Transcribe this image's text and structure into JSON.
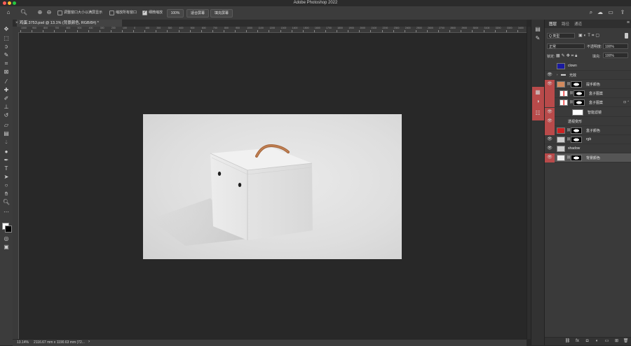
{
  "app": {
    "title": "Adobe Photoshop 2022"
  },
  "window_buttons": {
    "close": "#ff5f57",
    "minimize": "#febc2e",
    "zoom": "#28c840"
  },
  "options_bar": {
    "resize_windows_label": "调整窗口大小以满屏显示",
    "resize_windows_checked": false,
    "zoom_all_label": "缩放所有窗口",
    "zoom_all_checked": false,
    "scrubby_zoom_label": "细微缩放",
    "scrubby_zoom_checked": true,
    "percent_label": "100%",
    "fit_screen_label": "适合屏幕",
    "fill_screen_label": "填充屏幕"
  },
  "document": {
    "tab_title": "鸡蛋.3753.psd @ 13.1% (背景颜色, RGB/8#) *",
    "background_color": "#dedede"
  },
  "ruler": {
    "h_labels": [
      "1000",
      "900",
      "800",
      "700",
      "600",
      "500",
      "400",
      "300",
      "200",
      "100",
      "0",
      "100",
      "200",
      "300",
      "400",
      "500",
      "600",
      "700",
      "800",
      "900",
      "1000",
      "1100",
      "1200",
      "1300",
      "1400",
      "1500",
      "1600",
      "1700",
      "1800",
      "1900",
      "2000",
      "2100",
      "2200",
      "2300",
      "2400",
      "2500",
      "2600",
      "2700",
      "2800",
      "2900",
      "3000",
      "3100",
      "3200",
      "3300",
      "3400"
    ]
  },
  "status": {
    "zoom": "13.14%",
    "doc_size": "2116.67 mm x 1190.63 mm (72..."
  },
  "panel": {
    "tabs": [
      "图层",
      "路径",
      "通道"
    ],
    "active_tab": "图层",
    "kind_label": "Q 类型",
    "blend_mode": "正常",
    "opacity_label": "不透明度:",
    "opacity_value": "100%",
    "lock_label": "锁定:",
    "fill_label": "填充:",
    "fill_value": "100%"
  },
  "layers": [
    {
      "name": "clown",
      "visible": false,
      "color_tag": "",
      "thumb": "#1a1aa0",
      "kind": "layer",
      "indent": 0,
      "selected": false
    },
    {
      "name": "光效",
      "visible": true,
      "color_tag": "",
      "thumb": "folder",
      "kind": "group",
      "indent": 0,
      "selected": false
    },
    {
      "name": "提手颜色",
      "visible": true,
      "color_tag": "#b84a4a",
      "thumb": "#d28a5e",
      "mask": true,
      "kind": "layer",
      "indent": 0,
      "selected": false
    },
    {
      "name": "盒子图案",
      "visible": false,
      "color_tag": "#b84a4a",
      "thumb": "pattern",
      "mask": true,
      "kind": "layer",
      "indent": 1,
      "selected": false
    },
    {
      "name": "盒子图案",
      "visible": false,
      "color_tag": "#b84a4a",
      "thumb": "pattern",
      "mask": true,
      "kind": "smart",
      "indent": 1,
      "selected": false
    },
    {
      "name": "智能滤镜",
      "visible": true,
      "color_tag": "#b84a4a",
      "thumb": "white",
      "kind": "filter",
      "indent": 2,
      "selected": false
    },
    {
      "name": "透视变形",
      "visible": true,
      "color_tag": "#b84a4a",
      "thumb": "",
      "kind": "filter-item",
      "indent": 3,
      "selected": false
    },
    {
      "name": "盒子颜色",
      "visible": false,
      "color_tag": "#b84a4a",
      "thumb": "#cc2222",
      "mask": true,
      "kind": "layer",
      "indent": 0,
      "selected": false
    },
    {
      "name": "rgb",
      "visible": true,
      "color_tag": "",
      "thumb": "gray",
      "mask": true,
      "kind": "layer",
      "indent": 0,
      "selected": false
    },
    {
      "name": "shadow",
      "visible": true,
      "color_tag": "",
      "thumb": "gray",
      "kind": "layer",
      "indent": 0,
      "selected": false
    },
    {
      "name": "背景颜色",
      "visible": true,
      "color_tag": "#b84a4a",
      "thumb": "#eeeeee",
      "mask": true,
      "kind": "layer",
      "indent": 0,
      "selected": true
    }
  ],
  "icons": {
    "tools": [
      "move-icon",
      "marquee-icon",
      "lasso-icon",
      "quick-select-icon",
      "crop-icon",
      "frame-icon",
      "eyedropper-icon",
      "healing-icon",
      "brush-icon",
      "stamp-icon",
      "history-brush-icon",
      "eraser-icon",
      "gradient-icon",
      "blur-icon",
      "dodge-icon",
      "pen-icon",
      "type-icon",
      "path-select-icon",
      "shape-icon",
      "hand-icon",
      "zoom-icon",
      "more-icon"
    ]
  }
}
